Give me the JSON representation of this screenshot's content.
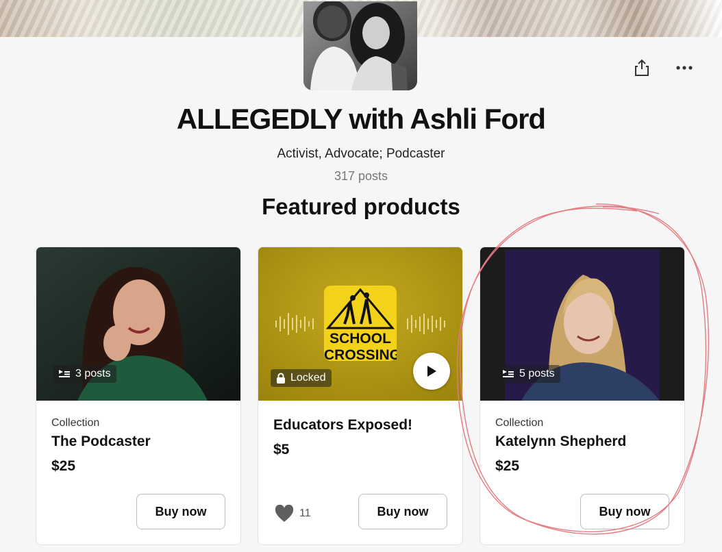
{
  "creator": {
    "name": "ALLEGEDLY with Ashli Ford",
    "tagline": "Activist, Advocate; Podcaster",
    "post_count": "317 posts"
  },
  "section_title": "Featured products",
  "icons": {
    "share": "share-icon",
    "more": "more-icon"
  },
  "products": [
    {
      "kind": "Collection",
      "name": "The Podcaster",
      "price": "$25",
      "badge": "3 posts",
      "button": "Buy now"
    },
    {
      "kind": "",
      "name": "Educators Exposed!",
      "price": "$5",
      "badge": "Locked",
      "sign_text": "SCHOOL",
      "sign_text_2": "CROSSING",
      "likes": "11",
      "button": "Buy now"
    },
    {
      "kind": "Collection",
      "name": "Katelynn Shepherd",
      "price": "$25",
      "badge": "5 posts",
      "button": "Buy now"
    }
  ],
  "colors": {
    "card_bg": "#ffffff",
    "page_bg": "#f6f6f6",
    "gold": "#b59a12",
    "sign_yellow": "#f3d21c",
    "annotation_red": "#e47b80"
  }
}
